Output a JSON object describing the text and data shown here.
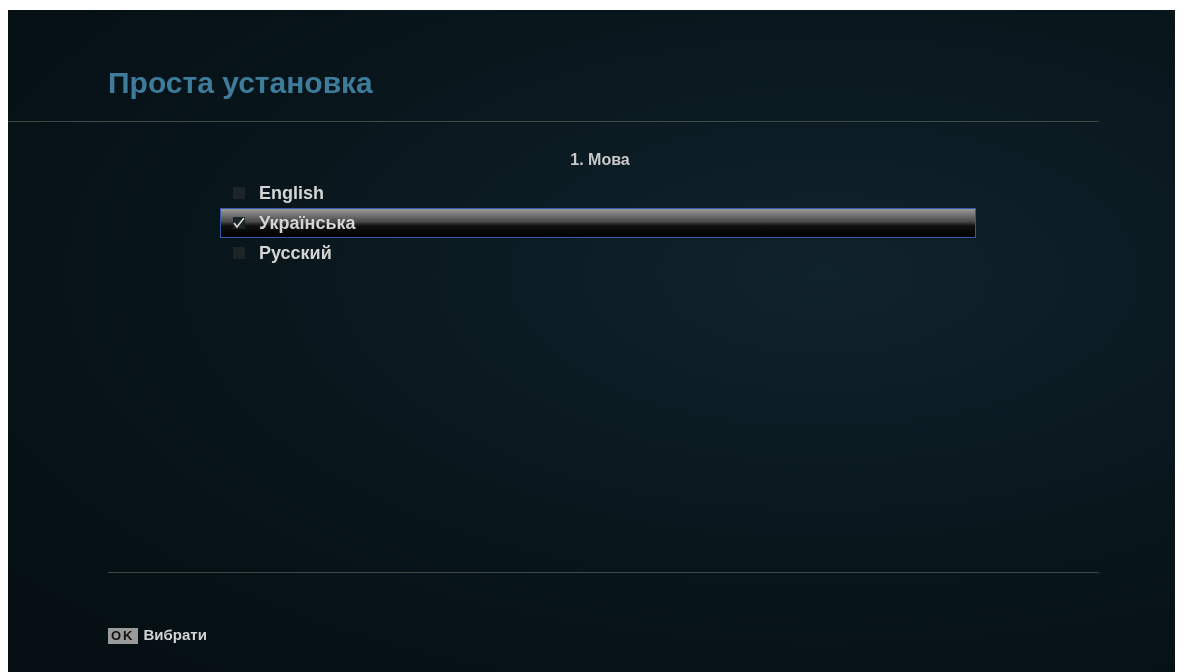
{
  "header": {
    "title": "Проста установка"
  },
  "step": {
    "title": "1. Мова"
  },
  "languages": [
    {
      "label": "English",
      "checked": false,
      "selected": false
    },
    {
      "label": "Українська",
      "checked": true,
      "selected": true
    },
    {
      "label": "Русский",
      "checked": false,
      "selected": false
    }
  ],
  "footer": {
    "key": "OK",
    "action": "Вибрати"
  }
}
